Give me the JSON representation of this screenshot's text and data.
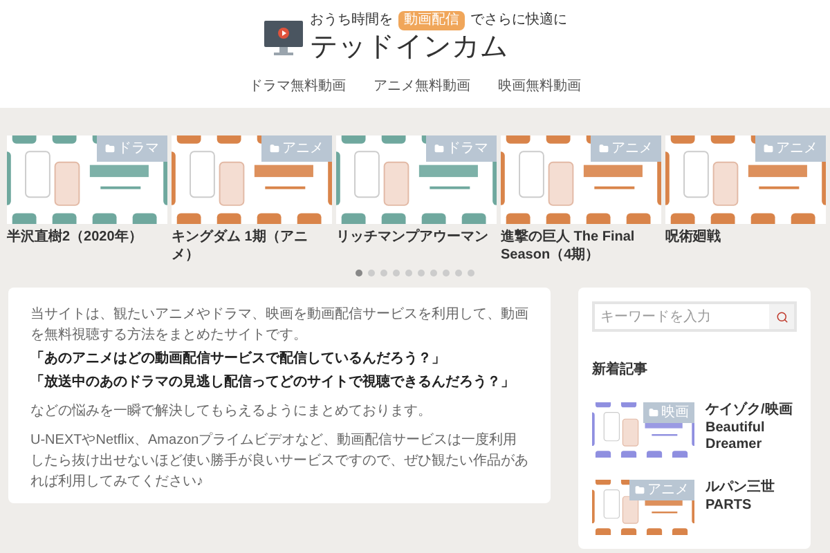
{
  "header": {
    "tagline_before": "おうち時間を",
    "tagline_badge": "動画配信",
    "tagline_after": "でさらに快適に",
    "site_title": "テッドインカム"
  },
  "nav": [
    "ドラマ無料動画",
    "アニメ無料動画",
    "映画無料動画"
  ],
  "carousel": [
    {
      "kind": "drama",
      "category": "ドラマ",
      "title": "半沢直樹2（2020年）"
    },
    {
      "kind": "anime",
      "category": "アニメ",
      "title": "キングダム 1期（アニメ）"
    },
    {
      "kind": "drama",
      "category": "ドラマ",
      "title": "リッチマンプアウーマン"
    },
    {
      "kind": "anime",
      "category": "アニメ",
      "title": "進撃の巨人 The Final Season（4期）"
    },
    {
      "kind": "anime",
      "category": "アニメ",
      "title": "呪術廻戦"
    }
  ],
  "carousel_dots": [
    {
      "selected": true
    },
    {
      "selected": false
    },
    {
      "selected": false
    },
    {
      "selected": false
    },
    {
      "selected": false
    },
    {
      "selected": false
    },
    {
      "selected": false
    },
    {
      "selected": false
    },
    {
      "selected": false
    },
    {
      "selected": false
    }
  ],
  "intro": [
    {
      "kind": "plain",
      "text": "当サイトは、観たいアニメやドラマ、映画を動画配信サービスを利用して、動画を無料視聴する方法をまとめたサイトです。"
    },
    {
      "kind": "bold",
      "text": "「あのアニメはどの動画配信サービスで配信しているんだろう？」"
    },
    {
      "kind": "bold",
      "text": "「放送中のあのドラマの見逃し配信ってどのサイトで視聴できるんだろう？」"
    },
    {
      "kind": "plain",
      "text": "などの悩みを一瞬で解決してもらえるようにまとめております。"
    },
    {
      "kind": "plain",
      "text": "U-NEXTやNetflix、Amazonプライムビデオなど、動画配信サービスは一度利用したら抜け出せないほど使い勝手が良いサービスですので、ぜひ観たい作品があれば利用してみてください♪"
    }
  ],
  "sidebar": {
    "search": {
      "placeholder": "キーワードを入力"
    },
    "heading": "新着記事",
    "articles": [
      {
        "kind": "movie",
        "category": "映画",
        "title": "ケイゾク/映画 Beautiful Dreamer"
      },
      {
        "kind": "anime",
        "category": "アニメ",
        "title": "ルパン三世 PARTS"
      }
    ]
  }
}
